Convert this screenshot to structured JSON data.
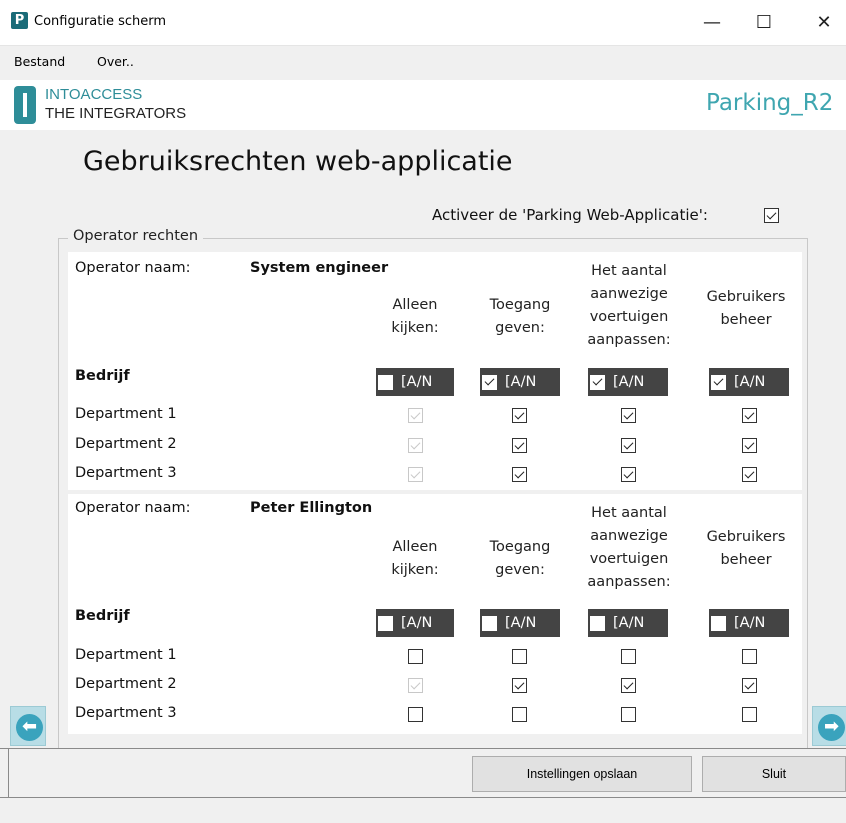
{
  "window": {
    "app_icon": "P",
    "title": "Configuratie scherm",
    "minimize": "—",
    "maximize": "☐",
    "close": "✕"
  },
  "menu": {
    "items": [
      "Bestand",
      "Over.."
    ]
  },
  "brand": {
    "line1": "INTOACCESS",
    "line2": "THE INTEGRATORS",
    "right": "Parking_R2",
    "accent_color": "#2e8d98"
  },
  "page_title": "Gebruiksrechten web-applicatie",
  "activate": {
    "label": "Activeer de 'Parking Web-Applicatie':",
    "checked": true
  },
  "group_legend": "Operator rechten",
  "columns": {
    "view": [
      "Alleen",
      "kijken:"
    ],
    "grant": [
      "Toegang",
      "geven:"
    ],
    "vehicles": [
      "Het aantal",
      "aanwezige",
      "voertuigen",
      "aanpassen:"
    ],
    "users": [
      "Gebruikers",
      "beheer"
    ]
  },
  "operator_label": "Operator naam:",
  "company_label": "Bedrijf",
  "all_label": "[A/N",
  "operators": [
    {
      "name": "System engineer",
      "all": [
        false,
        true,
        true,
        true
      ],
      "departments": [
        {
          "name": "Department 1",
          "checks": [
            "disabled",
            "checked",
            "checked",
            "checked"
          ]
        },
        {
          "name": "Department 2",
          "checks": [
            "disabled",
            "checked",
            "checked",
            "checked"
          ]
        },
        {
          "name": "Department 3",
          "checks": [
            "disabled",
            "checked",
            "checked",
            "checked"
          ]
        }
      ]
    },
    {
      "name": "Peter Ellington",
      "all": [
        false,
        false,
        false,
        false
      ],
      "departments": [
        {
          "name": "Department 1",
          "checks": [
            "unchecked",
            "unchecked",
            "unchecked",
            "unchecked"
          ]
        },
        {
          "name": "Department 2",
          "checks": [
            "disabled",
            "checked",
            "checked",
            "checked"
          ]
        },
        {
          "name": "Department 3",
          "checks": [
            "unchecked",
            "unchecked",
            "unchecked",
            "unchecked"
          ]
        }
      ]
    }
  ],
  "buttons": {
    "save": "Instellingen opslaan",
    "close": "Sluit"
  },
  "icons": {
    "nav_left": "left-arrow-icon",
    "nav_right": "right-arrow-icon"
  }
}
